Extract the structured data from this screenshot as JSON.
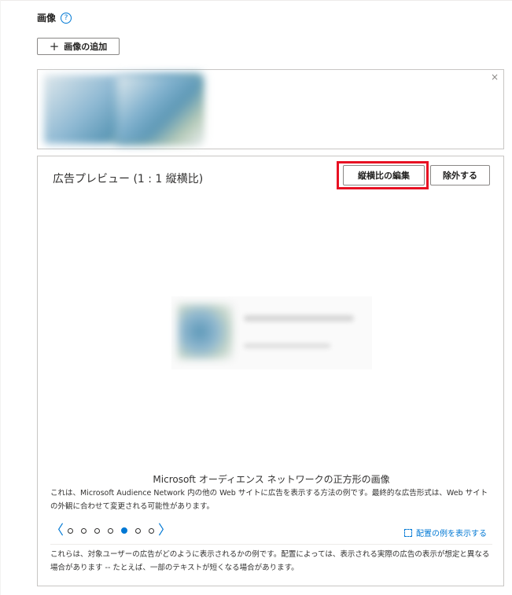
{
  "images_section": {
    "title": "画像",
    "help_icon": "?",
    "add_button": {
      "icon": "+",
      "label": "画像の追加"
    },
    "close_icon": "×"
  },
  "preview": {
    "title": "広告プレビュー (1 : 1 縦横比)",
    "edit_aspect_button": "縦横比の編集",
    "remove_button": "除外する",
    "caption_title": "Microsoft オーディエンス ネットワークの正方形の画像",
    "caption_desc": "これは、Microsoft Audience Network 内の他の Web サイトに広告を表示する方法の例です。最終的な広告形式は、Web サイトの外観に合わせて変更される可能性があります。",
    "carousel": {
      "prev": "〈",
      "next": "〉",
      "dots": 7,
      "active_index": 4
    },
    "example_link": "配置の例を表示する",
    "footer_note": "これらは、対象ユーザーの広告がどのように表示されるかの例です。配置によっては、表示される実際の広告の表示が想定と異なる場合があります -- たとえば、一部のテキストが短くなる場合があります。"
  },
  "colors": {
    "accent": "#0078d4",
    "highlight": "#e81123"
  }
}
